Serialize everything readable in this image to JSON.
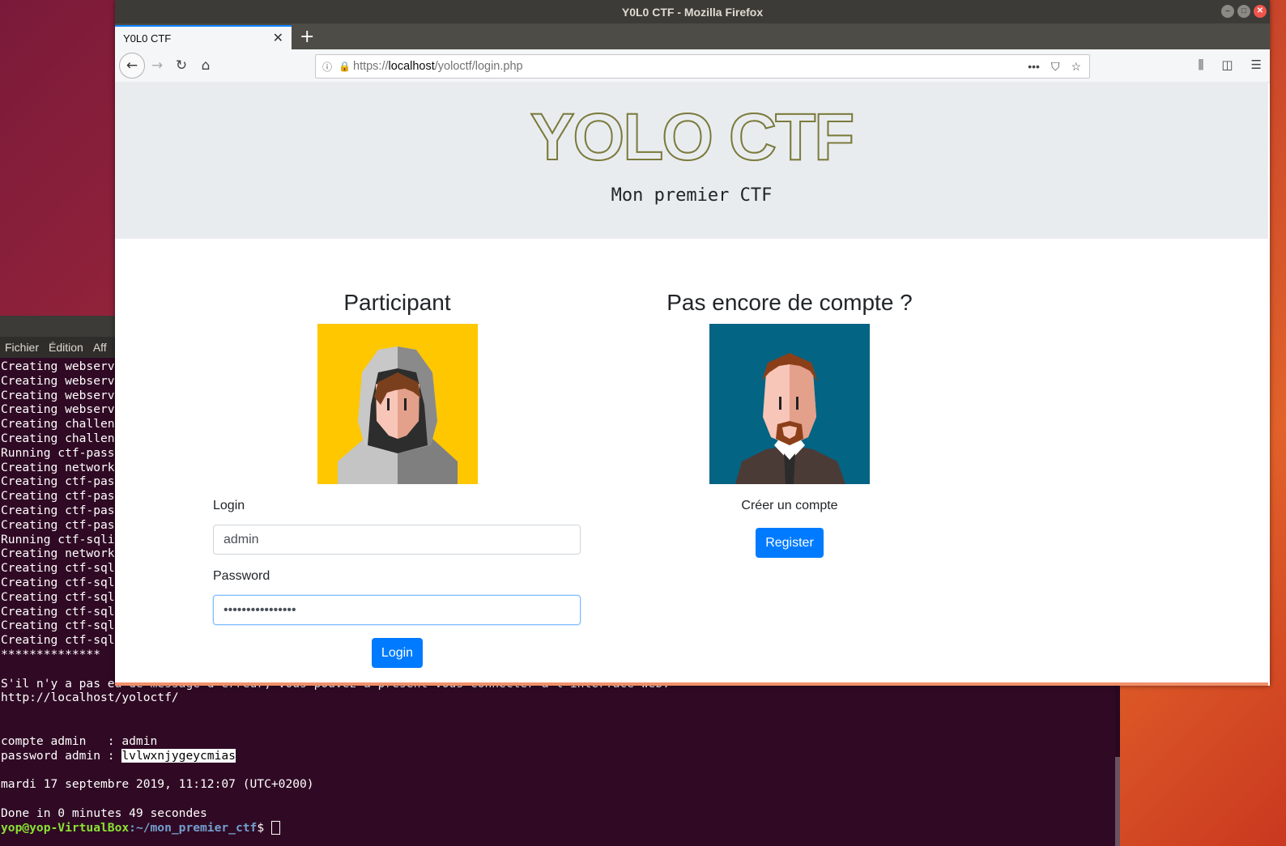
{
  "browser": {
    "window_title": "Y0L0 CTF - Mozilla Firefox",
    "tab_title": "Y0L0 CTF",
    "url_prefix": "https://",
    "url_host": "localhost",
    "url_path": "/yoloctf/login.php"
  },
  "page": {
    "logo_text": "YOLO CTF",
    "subtitle": "Mon premier CTF",
    "participant": {
      "heading": "Participant",
      "login_label": "Login",
      "login_value": "admin",
      "password_label": "Password",
      "password_value": "••••••••••••••••",
      "login_button": "Login"
    },
    "register": {
      "heading": "Pas encore de compte ?",
      "text": "Créer un compte",
      "button": "Register"
    }
  },
  "terminal": {
    "menu": [
      "Fichier",
      "Édition",
      "Aff"
    ],
    "lines": [
      "Creating webserv",
      "Creating webserv",
      "Creating webserv",
      "Creating webserv",
      "Creating challen",
      "Creating challen",
      "Running ctf-pass",
      "Creating network",
      "Creating ctf-pas",
      "Creating ctf-pas",
      "Creating ctf-pas",
      "Creating ctf-pas",
      "Running ctf-sqli",
      "Creating network",
      "Creating ctf-sql",
      "Creating ctf-sql",
      "Creating ctf-sql",
      "Creating ctf-sql",
      "Creating ctf-sql",
      "Creating ctf-sql",
      "**************",
      "",
      "S'il n'y a pas eu de message d'erreur, vous pouvez à présent vous connecter à l'interface web:",
      "http://localhost/yoloctf/",
      "",
      "",
      "compte admin   : admin"
    ],
    "password_prefix": "password admin : ",
    "password_value": "lvlwxnjygeycmias",
    "date_line": "mardi 17 septembre 2019, 11:12:07 (UTC+0200)",
    "done_line": "Done in 0 minutes 49 secondes",
    "prompt_user": "yop@yop-VirtualBox",
    "prompt_path": ":~/mon_premier_ctf",
    "prompt_symbol": "$ "
  }
}
